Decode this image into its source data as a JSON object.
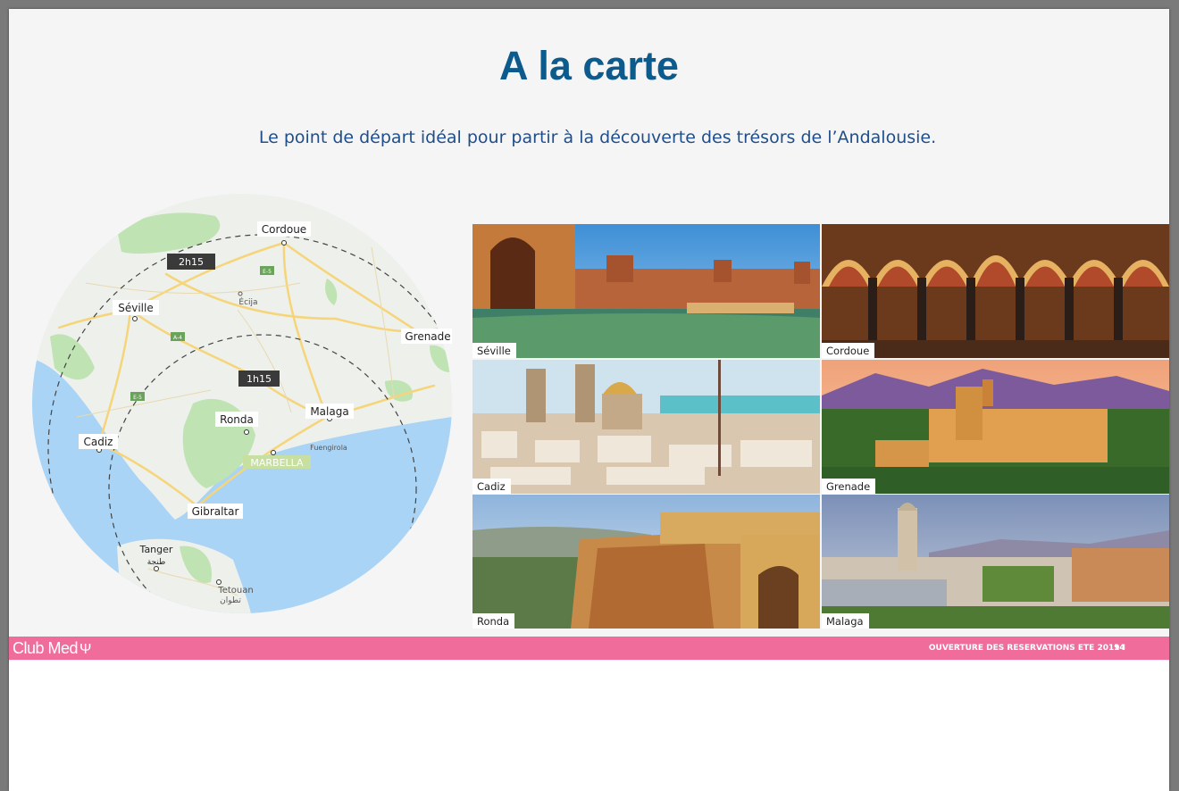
{
  "title": "A la carte",
  "subtitle": "Le point de départ idéal pour partir à la découverte des trésors de l’Andalousie.",
  "map": {
    "labels": {
      "cordoue": "Cordoue",
      "seville": "Séville",
      "grenade": "Grenade",
      "cadiz": "Cadiz",
      "ronda": "Ronda",
      "malaga": "Malaga",
      "gibraltar": "Gibraltar",
      "tanger": "Tanger",
      "tanger_ar": "طنجة",
      "tetouan": "Tetouan",
      "tetouan_ar": "تطوان",
      "ecija": "Écija",
      "fuengirola": "Fuengirola",
      "marbella": "MARBELLA"
    },
    "radius_labels": [
      "2h15",
      "1h15"
    ],
    "road_badges": [
      "E-5",
      "E-5",
      "A-4"
    ]
  },
  "photos": [
    {
      "label": "Séville"
    },
    {
      "label": "Cordoue"
    },
    {
      "label": "Cadiz"
    },
    {
      "label": "Grenade"
    },
    {
      "label": "Ronda"
    },
    {
      "label": "Malaga"
    }
  ],
  "footer": {
    "logo": "Club Med",
    "logo_mark": "Ψ",
    "text": "OUVERTURE DES RESERVATIONS ETE 2019 I",
    "page_number": "14"
  },
  "colors": {
    "title": "#0d5a8c",
    "subtitle": "#1f4e8a",
    "footer": "#f06d9b",
    "sea": "#a9d4f5",
    "land": "#eef0ec",
    "road": "#f6d57a"
  }
}
